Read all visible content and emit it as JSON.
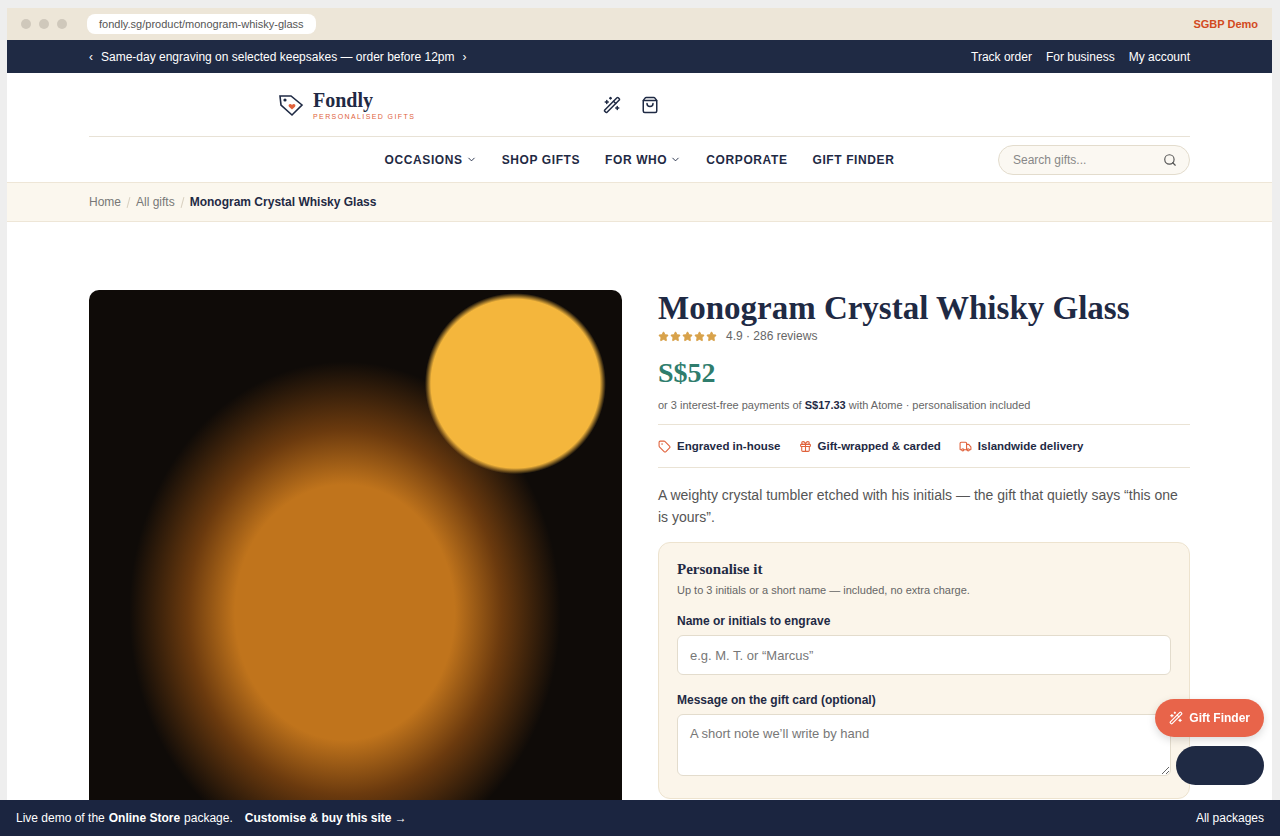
{
  "browser": {
    "url": "fondly.sg/product/monogram-whisky-glass",
    "badge": "SGBP Demo"
  },
  "announcement": {
    "prev": "‹",
    "text": "Same-day engraving on selected keepsakes — order before 12pm",
    "next": "›",
    "links": [
      "Track order",
      "For business",
      "My account"
    ]
  },
  "brand": {
    "name": "Fondly",
    "tagline": "PERSONALISED GIFTS"
  },
  "nav": [
    {
      "label": "OCCASIONS",
      "dropdown": true
    },
    {
      "label": "SHOP GIFTS",
      "dropdown": false
    },
    {
      "label": "FOR WHO",
      "dropdown": true
    },
    {
      "label": "CORPORATE",
      "dropdown": false
    },
    {
      "label": "GIFT FINDER",
      "dropdown": false
    }
  ],
  "search": {
    "placeholder": "Search gifts..."
  },
  "breadcrumb": [
    {
      "label": "Home",
      "current": false
    },
    {
      "label": "All gifts",
      "current": false
    },
    {
      "label": "Monogram Crystal Whisky Glass",
      "current": true
    }
  ],
  "product": {
    "title": "Monogram Crystal Whisky Glass",
    "stars": 5,
    "rating_text": "4.9 · 286 reviews",
    "price": "S$52",
    "installments": {
      "before": "or 3 interest-free payments of",
      "amount": "S$17.33",
      "after": "with Atome · personalisation included"
    },
    "features": [
      {
        "label": "Engraved in-house",
        "kind": "tag"
      },
      {
        "label": "Gift-wrapped & carded",
        "kind": "gift"
      },
      {
        "label": "Islandwide delivery",
        "kind": "truck"
      }
    ],
    "description": "A weighty crystal tumbler etched with his initials — the gift that quietly says “this one is yours”."
  },
  "personalise": {
    "title": "Personalise it",
    "subtitle": "Up to 3 initials or a short name — included, no extra charge.",
    "fields": [
      {
        "label": "Name or initials to engrave",
        "placeholder": "e.g. M. T. or “Marcus”",
        "kind": "input"
      },
      {
        "label": "Message on the gift card (optional)",
        "placeholder": "A short note we’ll write by hand",
        "kind": "textarea"
      }
    ]
  },
  "floating": {
    "gift_finder": "Gift Finder"
  },
  "demo_bar": {
    "text": "Live demo of the",
    "package": "Online Store",
    "suffix": "package.",
    "cta": "Customise & buy this site →",
    "right": "All packages"
  }
}
